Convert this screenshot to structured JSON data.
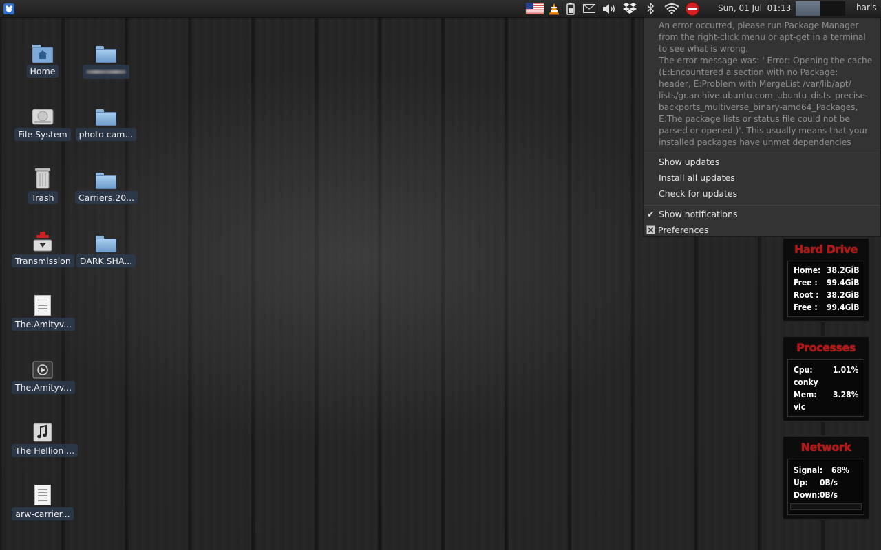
{
  "panel": {
    "date": "Sun, 01 Jul",
    "time": "01:13",
    "user": "haris"
  },
  "desktop": {
    "icons_col1": [
      {
        "label": "Home",
        "icon": "home-folder-icon"
      },
      {
        "label": "File System",
        "icon": "hard-disk-icon"
      },
      {
        "label": "Trash",
        "icon": "trash-icon"
      },
      {
        "label": "Transmission",
        "icon": "transmission-icon"
      },
      {
        "label": "The.Amityv...",
        "icon": "text-document-icon"
      },
      {
        "label": "The.Amityv...",
        "icon": "video-file-icon"
      },
      {
        "label": "The Hellion ...",
        "icon": "audio-file-icon"
      },
      {
        "label": "arw-carrier...",
        "icon": "text-document-icon"
      }
    ],
    "icons_col2": [
      {
        "label": "",
        "icon": "folder-icon"
      },
      {
        "label": "photo cam...",
        "icon": "folder-icon"
      },
      {
        "label": "Carriers.20...",
        "icon": "folder-icon"
      },
      {
        "label": "DARK.SHA...",
        "icon": "folder-icon"
      }
    ]
  },
  "update_menu": {
    "error_lines": [
      "An error occurred, please run Package Manager",
      "from the right-click menu or apt-get in a terminal",
      "to see what is wrong.",
      "The error message was: ' Error: Opening the cache",
      "(E:Encountered a section with no Package:",
      "header, E:Problem with MergeList /var/lib/apt/",
      "lists/gr.archive.ubuntu.com_ubuntu_dists_precise-",
      "backports_multiverse_binary-amd64_Packages,",
      "E:The package lists or status file could not be",
      "parsed or opened.)'. This usually means that your",
      "installed packages have unmet dependencies"
    ],
    "show_updates": "Show updates",
    "install_all": "Install all updates",
    "check": "Check for updates",
    "show_notifications": "Show notifications",
    "show_notifications_checked": true,
    "preferences": "Preferences"
  },
  "conky": {
    "hard_drive": {
      "title": "Hard Drive",
      "rows": [
        {
          "label": "Home:",
          "value": "38.2GiB"
        },
        {
          "label": "Free :",
          "value": "99.4GiB"
        },
        {
          "label": "Root :",
          "value": "38.2GiB"
        },
        {
          "label": "Free :",
          "value": "99.4GiB"
        }
      ]
    },
    "processes": {
      "title": "Processes",
      "cpu_label": "Cpu:",
      "cpu_value": "1.01%",
      "cpu_proc": "conky",
      "mem_label": "Mem:",
      "mem_value": "3.28%",
      "mem_proc": "vlc"
    },
    "network": {
      "title": "Network",
      "signal_label": "Signal:",
      "signal_value": "68%",
      "up_label": "Up:",
      "up_value": "0B/s",
      "down_label": "Down:",
      "down_value": "0B/s"
    }
  },
  "colors": {
    "conky_title": "#b01818",
    "menu_bg": "#333333",
    "label_bg": "#2d3a4e"
  }
}
